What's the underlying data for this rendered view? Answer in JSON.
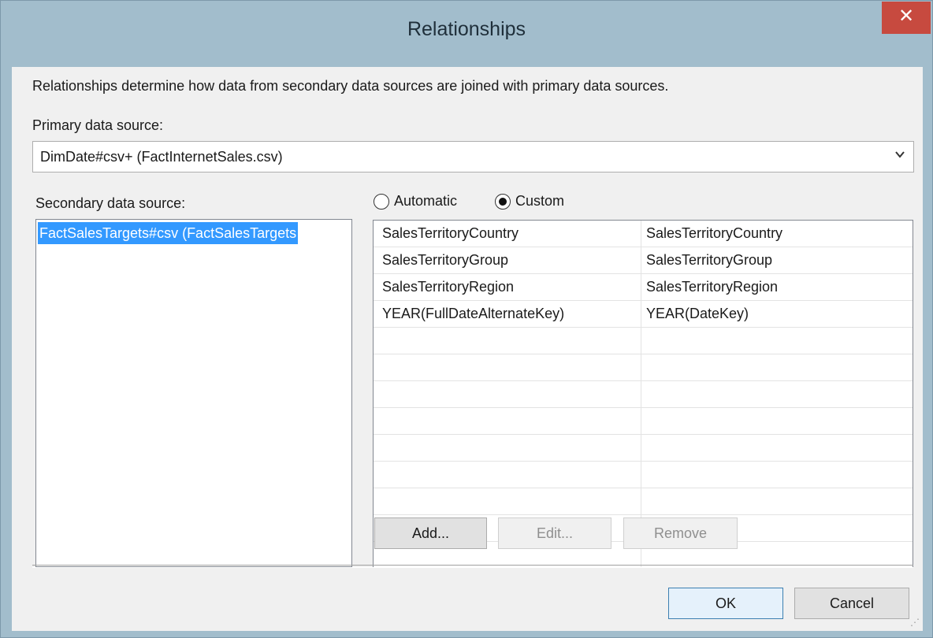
{
  "window": {
    "title": "Relationships",
    "close_glyph": "✕"
  },
  "description": "Relationships determine how data from secondary data sources are joined with primary data sources.",
  "primary": {
    "label": "Primary data source:",
    "value": "DimDate#csv+ (FactInternetSales.csv)"
  },
  "secondary": {
    "label": "Secondary data source:",
    "items": [
      "FactSalesTargets#csv (FactSalesTargets"
    ],
    "selected_index": 0
  },
  "mode": {
    "options": [
      {
        "label": "Automatic",
        "selected": false
      },
      {
        "label": "Custom",
        "selected": true
      }
    ]
  },
  "mappings": {
    "rows": [
      {
        "primary": "SalesTerritoryCountry",
        "secondary": "SalesTerritoryCountry"
      },
      {
        "primary": "SalesTerritoryGroup",
        "secondary": "SalesTerritoryGroup"
      },
      {
        "primary": "SalesTerritoryRegion",
        "secondary": "SalesTerritoryRegion"
      },
      {
        "primary": "YEAR(FullDateAlternateKey)",
        "secondary": "YEAR(DateKey)"
      },
      {
        "primary": "",
        "secondary": ""
      },
      {
        "primary": "",
        "secondary": ""
      },
      {
        "primary": "",
        "secondary": ""
      },
      {
        "primary": "",
        "secondary": ""
      },
      {
        "primary": "",
        "secondary": ""
      },
      {
        "primary": "",
        "secondary": ""
      },
      {
        "primary": "",
        "secondary": ""
      },
      {
        "primary": "",
        "secondary": ""
      },
      {
        "primary": "",
        "secondary": ""
      }
    ]
  },
  "buttons": {
    "add": "Add...",
    "edit": "Edit...",
    "remove": "Remove",
    "ok": "OK",
    "cancel": "Cancel"
  },
  "icons": {
    "dropdown": "chevron-down-icon",
    "close": "close-icon",
    "grip": "resize-grip-icon"
  }
}
